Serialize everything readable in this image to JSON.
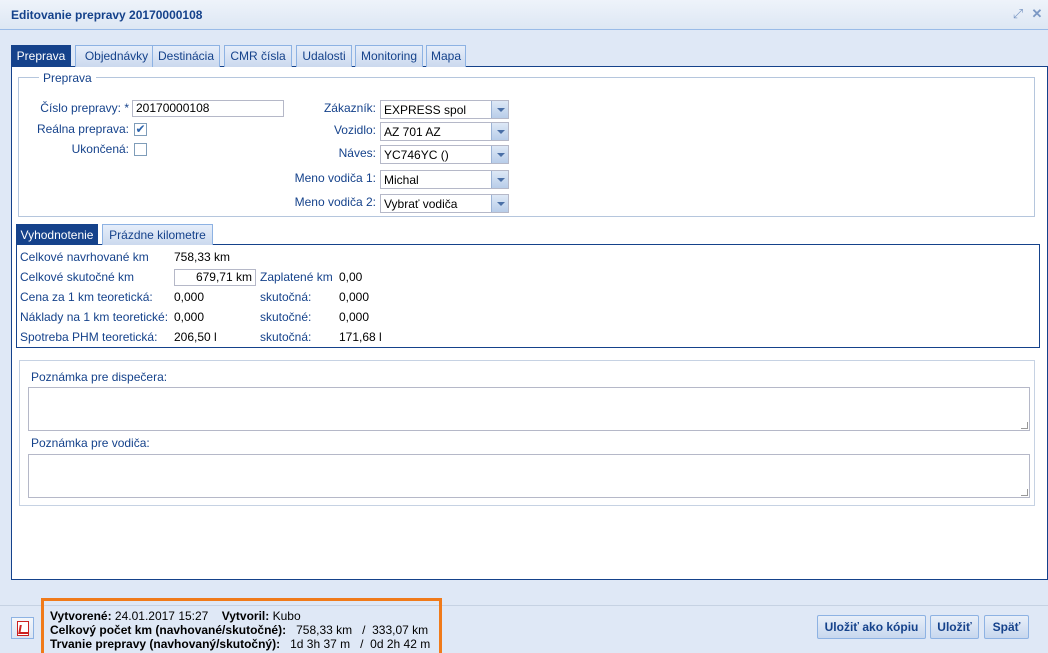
{
  "window": {
    "title": "Editovanie prepravy 20170000108",
    "restore_icon": "restore-icon",
    "close_icon": "close-icon"
  },
  "tabs": [
    "Preprava",
    "Objednávky",
    "Destinácia",
    "CMR čísla",
    "Udalosti",
    "Monitoring",
    "Mapa"
  ],
  "active_tab": "Preprava",
  "preprava": {
    "legend": "Preprava",
    "cislo_label": "Číslo prepravy: *",
    "cislo_value": "20170000108",
    "realna_label": "Reálna preprava:",
    "realna_checked": true,
    "ukoncena_label": "Ukončená:",
    "ukoncena_checked": false,
    "zakaznik_label": "Zákazník:",
    "zakaznik_value": "EXPRESS spol",
    "vozidlo_label": "Vozidlo:",
    "vozidlo_value": "AZ 701 AZ",
    "naves_label": "Náves:",
    "naves_value": "YC746YC ()",
    "vodic1_label": "Meno vodiča 1:",
    "vodic1_value": "Michal",
    "vodic2_label": "Meno vodiča 2:",
    "vodic2_value": "Vybrať vodiča"
  },
  "subtabs": [
    "Vyhodnotenie",
    "Prázdne kilometre"
  ],
  "active_subtab": "Vyhodnotenie",
  "vyhodnotenie": {
    "navrhovane_label": "Celkové navrhované km",
    "navrhovane_value": "758,33 km",
    "skutocne_label": "Celkové skutočné km",
    "skutocne_value": "679,71 km",
    "zaplatene_label": "Zaplatené km",
    "zaplatene_value": "0,00",
    "cena_label": "Cena za 1 km teoretická:",
    "cena_value": "0,000",
    "cena_skut_label": "skutočná:",
    "cena_skut_value": "0,000",
    "naklady_label": "Náklady na 1 km teoretické:",
    "naklady_value": "0,000",
    "naklady_skut_label": "skutočné:",
    "naklady_skut_value": "0,000",
    "spotreba_label": "Spotreba PHM teoretická:",
    "spotreba_value": "206,50 l",
    "spotreba_skut_label": "skutočná:",
    "spotreba_skut_value": "171,68 l"
  },
  "notes": {
    "dispecer_label": "Poznámka pre dispečera:",
    "vodic_label": "Poznámka pre vodiča:"
  },
  "footer": {
    "pdf_icon": "pdf-icon",
    "vytvorene_label": "Vytvorené:",
    "vytvorene_value": "24.01.2017 15:27",
    "vytvoril_label": "Vytvoril:",
    "vytvoril_value": "Kubo",
    "km_label": "Celkový počet km (navhované/skutočné):",
    "km_value": "758,33 km   /  333,07 km",
    "trvanie_label": "Trvanie prepravy (navhovaný/skutočný):",
    "trvanie_value": "1d 3h 37 m   /  0d 2h 42 m",
    "save_copy_label": "Uložiť ako kópiu",
    "save_label": "Uložiť",
    "back_label": "Späť"
  }
}
